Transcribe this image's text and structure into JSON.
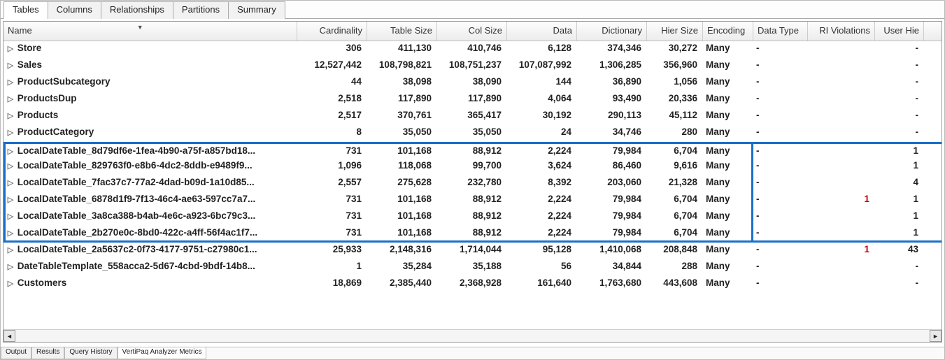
{
  "top_tabs": [
    "Tables",
    "Columns",
    "Relationships",
    "Partitions",
    "Summary"
  ],
  "active_top_tab": 0,
  "bottom_tabs": [
    "Output",
    "Results",
    "Query History",
    "VertiPaq Analyzer Metrics"
  ],
  "active_bottom_tab": 3,
  "columns": [
    {
      "key": "name",
      "label": "Name",
      "w": "w-name",
      "align": "txt"
    },
    {
      "key": "card",
      "label": "Cardinality",
      "w": "w-card",
      "align": "num"
    },
    {
      "key": "tsize",
      "label": "Table Size",
      "w": "w-tsize",
      "align": "num"
    },
    {
      "key": "csize",
      "label": "Col Size",
      "w": "w-csize",
      "align": "num"
    },
    {
      "key": "data",
      "label": "Data",
      "w": "w-data",
      "align": "num"
    },
    {
      "key": "dict",
      "label": "Dictionary",
      "w": "w-dict",
      "align": "num"
    },
    {
      "key": "hier",
      "label": "Hier Size",
      "w": "w-hier",
      "align": "num"
    },
    {
      "key": "enc",
      "label": "Encoding",
      "w": "w-enc",
      "align": "txt"
    },
    {
      "key": "dtype",
      "label": "Data Type",
      "w": "w-dtype",
      "align": "txt"
    },
    {
      "key": "ri",
      "label": "RI Violations",
      "w": "w-ri",
      "align": "num"
    },
    {
      "key": "uhier",
      "label": "User Hie",
      "w": "w-uhier",
      "align": "num"
    }
  ],
  "highlight_rows": [
    6,
    7,
    8,
    9,
    10,
    11
  ],
  "highlight_right_col": "enc",
  "rows": [
    {
      "name": "Store",
      "card": "306",
      "tsize": "411,130",
      "csize": "410,746",
      "data": "6,128",
      "dict": "374,346",
      "hier": "30,272",
      "enc": "Many",
      "dtype": "-",
      "ri": "",
      "uhier": "-"
    },
    {
      "name": "Sales",
      "card": "12,527,442",
      "tsize": "108,798,821",
      "csize": "108,751,237",
      "data": "107,087,992",
      "dict": "1,306,285",
      "hier": "356,960",
      "enc": "Many",
      "dtype": "-",
      "ri": "",
      "uhier": "-"
    },
    {
      "name": "ProductSubcategory",
      "card": "44",
      "tsize": "38,098",
      "csize": "38,090",
      "data": "144",
      "dict": "36,890",
      "hier": "1,056",
      "enc": "Many",
      "dtype": "-",
      "ri": "",
      "uhier": "-"
    },
    {
      "name": "ProductsDup",
      "card": "2,518",
      "tsize": "117,890",
      "csize": "117,890",
      "data": "4,064",
      "dict": "93,490",
      "hier": "20,336",
      "enc": "Many",
      "dtype": "-",
      "ri": "",
      "uhier": "-"
    },
    {
      "name": "Products",
      "card": "2,517",
      "tsize": "370,761",
      "csize": "365,417",
      "data": "30,192",
      "dict": "290,113",
      "hier": "45,112",
      "enc": "Many",
      "dtype": "-",
      "ri": "",
      "uhier": "-"
    },
    {
      "name": "ProductCategory",
      "card": "8",
      "tsize": "35,050",
      "csize": "35,050",
      "data": "24",
      "dict": "34,746",
      "hier": "280",
      "enc": "Many",
      "dtype": "-",
      "ri": "",
      "uhier": "-"
    },
    {
      "name": "LocalDateTable_8d79df6e-1fea-4b90-a75f-a857bd18...",
      "card": "731",
      "tsize": "101,168",
      "csize": "88,912",
      "data": "2,224",
      "dict": "79,984",
      "hier": "6,704",
      "enc": "Many",
      "dtype": "-",
      "ri": "",
      "uhier": "1"
    },
    {
      "name": "LocalDateTable_829763f0-e8b6-4dc2-8ddb-e9489f9...",
      "card": "1,096",
      "tsize": "118,068",
      "csize": "99,700",
      "data": "3,624",
      "dict": "86,460",
      "hier": "9,616",
      "enc": "Many",
      "dtype": "-",
      "ri": "",
      "uhier": "1"
    },
    {
      "name": "LocalDateTable_7fac37c7-77a2-4dad-b09d-1a10d85...",
      "card": "2,557",
      "tsize": "275,628",
      "csize": "232,780",
      "data": "8,392",
      "dict": "203,060",
      "hier": "21,328",
      "enc": "Many",
      "dtype": "-",
      "ri": "",
      "uhier": "4"
    },
    {
      "name": "LocalDateTable_6878d1f9-7f13-46c4-ae63-597cc7a7...",
      "card": "731",
      "tsize": "101,168",
      "csize": "88,912",
      "data": "2,224",
      "dict": "79,984",
      "hier": "6,704",
      "enc": "Many",
      "dtype": "-",
      "ri": "1",
      "ri_red": true,
      "uhier": "1"
    },
    {
      "name": "LocalDateTable_3a8ca388-b4ab-4e6c-a923-6bc79c3...",
      "card": "731",
      "tsize": "101,168",
      "csize": "88,912",
      "data": "2,224",
      "dict": "79,984",
      "hier": "6,704",
      "enc": "Many",
      "dtype": "-",
      "ri": "",
      "uhier": "1"
    },
    {
      "name": "LocalDateTable_2b270e0c-8bd0-422c-a4ff-56f4ac1f7...",
      "card": "731",
      "tsize": "101,168",
      "csize": "88,912",
      "data": "2,224",
      "dict": "79,984",
      "hier": "6,704",
      "enc": "Many",
      "dtype": "-",
      "ri": "",
      "uhier": "1"
    },
    {
      "name": "LocalDateTable_2a5637c2-0f73-4177-9751-c27980c1...",
      "card": "25,933",
      "tsize": "2,148,316",
      "csize": "1,714,044",
      "data": "95,128",
      "dict": "1,410,068",
      "hier": "208,848",
      "enc": "Many",
      "dtype": "-",
      "ri": "1",
      "ri_red": true,
      "uhier": "43"
    },
    {
      "name": "DateTableTemplate_558acca2-5d67-4cbd-9bdf-14b8...",
      "card": "1",
      "tsize": "35,284",
      "csize": "35,188",
      "data": "56",
      "dict": "34,844",
      "hier": "288",
      "enc": "Many",
      "dtype": "-",
      "ri": "",
      "uhier": "-"
    },
    {
      "name": "Customers",
      "card": "18,869",
      "tsize": "2,385,440",
      "csize": "2,368,928",
      "data": "161,640",
      "dict": "1,763,680",
      "hier": "443,608",
      "enc": "Many",
      "dtype": "-",
      "ri": "",
      "uhier": "-"
    }
  ]
}
